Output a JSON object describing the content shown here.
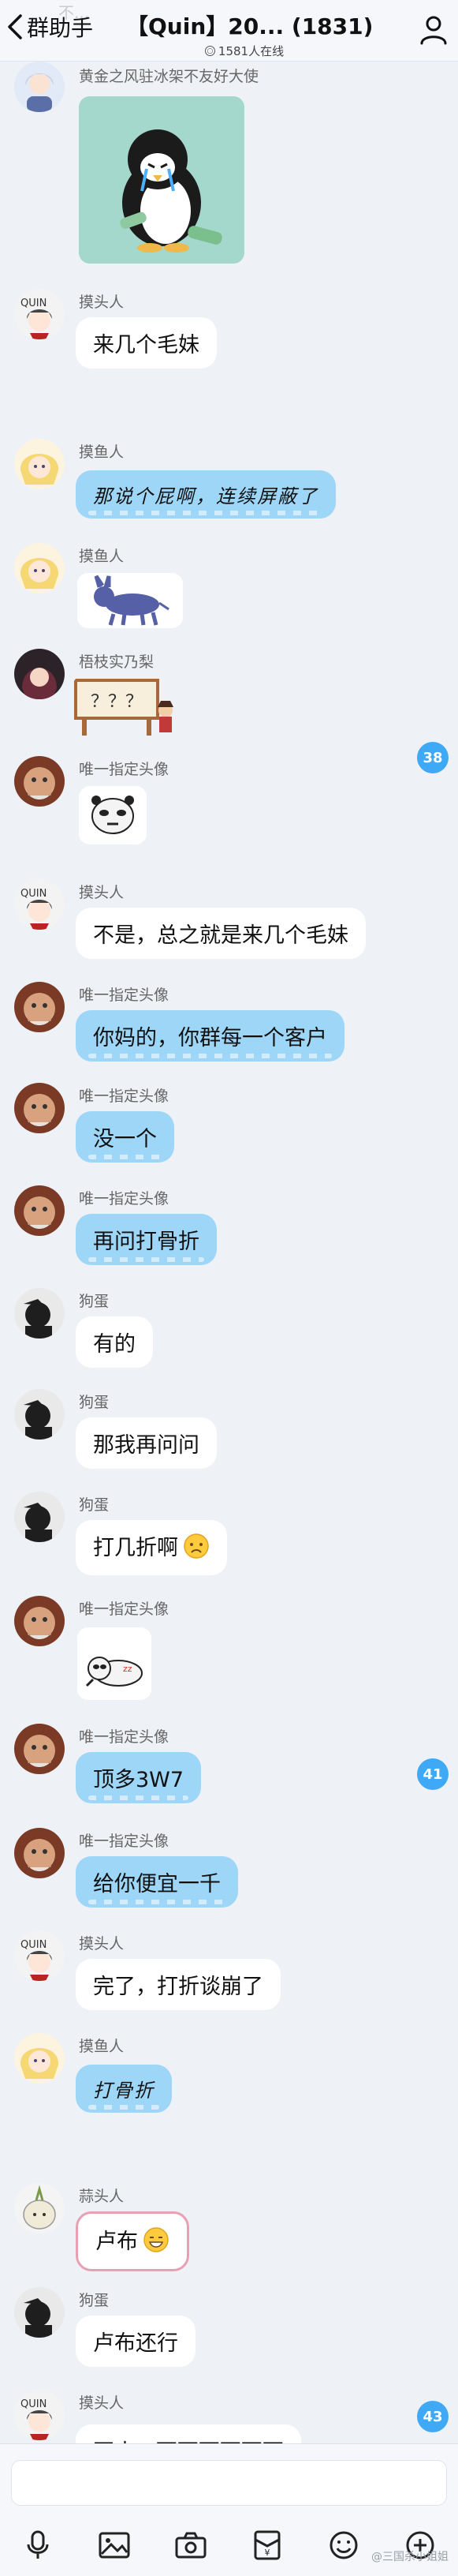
{
  "header": {
    "back_label": "群助手",
    "title": "【Quin】20... (1831)",
    "online": "1581人在线",
    "ghost_tip": "不..."
  },
  "messages": [
    {
      "sender": "黄金之风驻冰架不友好大使",
      "type": "sticker",
      "sticker": "penguin-crying-sticker"
    },
    {
      "sender": "摸头人",
      "type": "text",
      "text": "来几个毛妹"
    },
    {
      "sender": "摸鱼人",
      "type": "text",
      "style": "blue-hand",
      "text": "那说个屁啊，连续屏蔽了"
    },
    {
      "sender": "摸鱼人",
      "type": "sticker",
      "sticker": "donkey-sticker"
    },
    {
      "sender": "梧枝实乃梨",
      "type": "sticker",
      "sticker": "question-sign-sticker",
      "sticker_text": "？？？"
    },
    {
      "sender": "唯一指定头像",
      "type": "sticker",
      "sticker": "panda-face-sticker"
    },
    {
      "sender": "摸头人",
      "type": "text",
      "text": "不是，总之就是来几个毛妹"
    },
    {
      "sender": "唯一指定头像",
      "type": "text",
      "style": "blue",
      "text": "你妈的，你群每一个客户"
    },
    {
      "sender": "唯一指定头像",
      "type": "text",
      "style": "blue",
      "text": "没一个"
    },
    {
      "sender": "唯一指定头像",
      "type": "text",
      "style": "blue",
      "text": "再问打骨折"
    },
    {
      "sender": "狗蛋",
      "type": "text",
      "text": "有的"
    },
    {
      "sender": "狗蛋",
      "type": "text",
      "text": "那我再问问"
    },
    {
      "sender": "狗蛋",
      "type": "text",
      "text": "打几折啊",
      "emoji": "sad-face-emoji"
    },
    {
      "sender": "唯一指定头像",
      "type": "sticker",
      "sticker": "lying-panda-sticker"
    },
    {
      "sender": "唯一指定头像",
      "type": "text",
      "style": "blue",
      "text": "顶多3W7"
    },
    {
      "sender": "唯一指定头像",
      "type": "text",
      "style": "blue",
      "text": "给你便宜一千"
    },
    {
      "sender": "摸头人",
      "type": "text",
      "text": "完了，打折谈崩了"
    },
    {
      "sender": "摸鱼人",
      "type": "text",
      "style": "blue-hand",
      "text": "打骨折"
    },
    {
      "sender": "蒜头人",
      "type": "text",
      "style": "pink",
      "text": "卢布",
      "emoji": "grin-emoji"
    },
    {
      "sender": "狗蛋",
      "type": "text",
      "text": "卢布还行"
    },
    {
      "sender": "摸头人",
      "type": "text",
      "text": "再来...死死死死死死"
    }
  ],
  "unread_badges": [
    "38",
    "41",
    "43"
  ],
  "toolbar": [
    "microphone-icon",
    "image-icon",
    "camera-icon",
    "red-packet-icon",
    "emoji-icon",
    "plus-icon"
  ],
  "watermark": "@三国杀小姐姐",
  "colors": {
    "background": "#eef1f6",
    "blue_bubble": "#9ed6f8",
    "badge": "#3fa9f5"
  }
}
